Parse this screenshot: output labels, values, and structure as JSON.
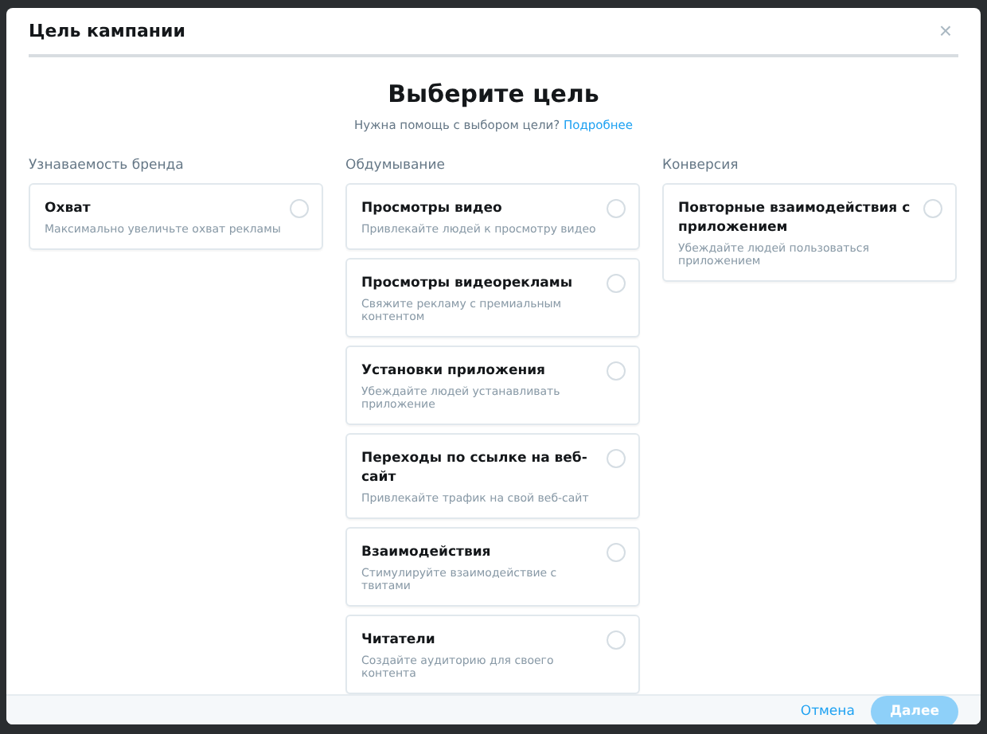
{
  "dialog": {
    "title": "Цель кампании",
    "close": "×"
  },
  "heading": "Выберите цель",
  "help": {
    "text": "Нужна помощь с выбором цели?",
    "link": "Подробнее"
  },
  "columns": [
    {
      "label": "Узнаваемость бренда",
      "options": [
        {
          "title": "Охват",
          "description": "Максимально увеличьте охват рекламы",
          "selected": false
        }
      ]
    },
    {
      "label": "Обдумывание",
      "options": [
        {
          "title": "Просмотры видео",
          "description": "Привлекайте людей к просмотру видео",
          "selected": false
        },
        {
          "title": "Просмотры видеорекламы",
          "description": "Свяжите рекламу с премиальным контентом",
          "selected": false
        },
        {
          "title": "Установки приложения",
          "description": "Убеждайте людей устанавливать приложение",
          "selected": false
        },
        {
          "title": "Переходы по ссылке на веб-сайт",
          "description": "Привлекайте трафик на свой веб-сайт",
          "selected": false
        },
        {
          "title": "Взаимодействия",
          "description": "Стимулируйте взаимодействие с твитами",
          "selected": false
        },
        {
          "title": "Читатели",
          "description": "Создайте аудиторию для своего контента",
          "selected": false
        }
      ]
    },
    {
      "label": "Конверсия",
      "options": [
        {
          "title": "Повторные взаимодействия с приложением",
          "description": "Убеждайте людей пользоваться приложением",
          "selected": false
        }
      ]
    }
  ],
  "footer": {
    "cancel": "Отмена",
    "next": {
      "label": "Далее",
      "disabled": true
    }
  }
}
